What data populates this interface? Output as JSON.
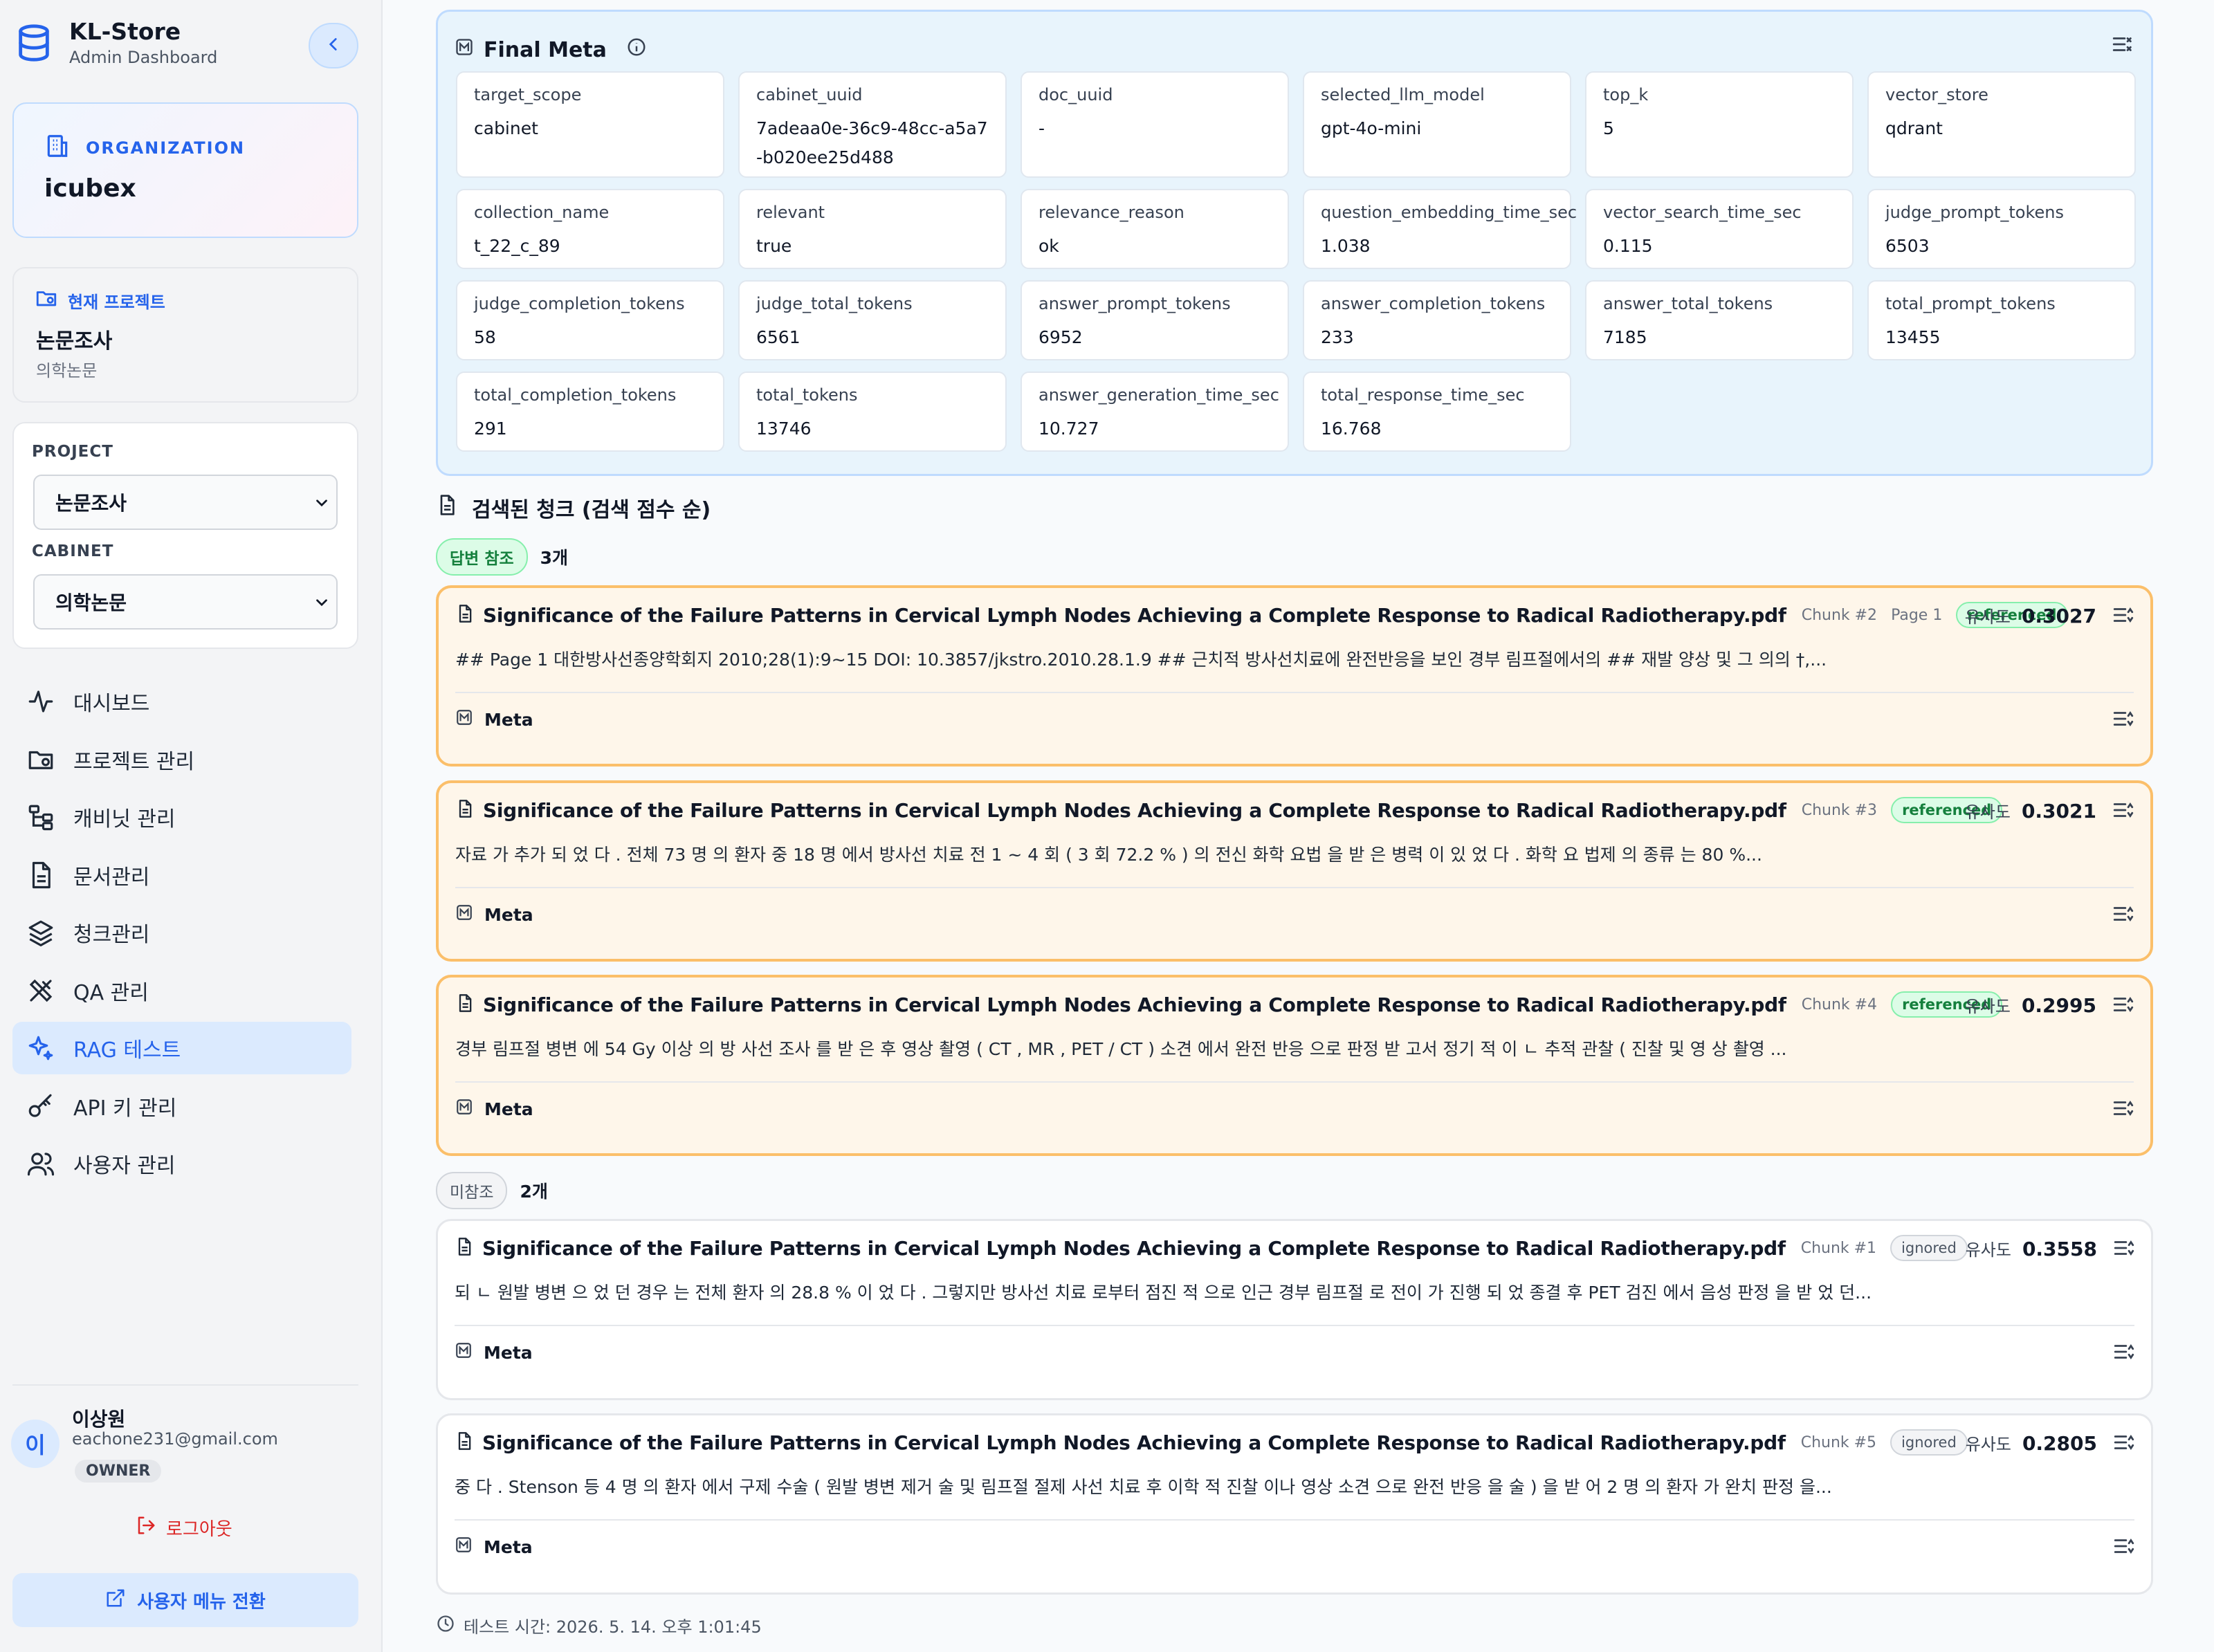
{
  "sidebar": {
    "brand_title": "KL-Store",
    "brand_sub": "Admin Dashboard",
    "org_label": "ORGANIZATION",
    "org_name": "icubex",
    "current_project_label": "현재 프로젝트",
    "current_project_name": "논문조사",
    "current_project_sub": "의학논문",
    "project_label": "PROJECT",
    "project_value": "논문조사",
    "cabinet_label": "CABINET",
    "cabinet_value": "의학논문",
    "nav": [
      {
        "label": "대시보드",
        "icon": "activity-icon"
      },
      {
        "label": "프로젝트 관리",
        "icon": "folder-cog-icon"
      },
      {
        "label": "캐비닛 관리",
        "icon": "tree-icon"
      },
      {
        "label": "문서관리",
        "icon": "file-text-icon"
      },
      {
        "label": "청크관리",
        "icon": "layers-icon"
      },
      {
        "label": "QA 관리",
        "icon": "tools-icon"
      },
      {
        "label": "RAG 테스트",
        "icon": "sparkles-icon",
        "active": true
      },
      {
        "label": "API 키 관리",
        "icon": "key-icon"
      },
      {
        "label": "사용자 관리",
        "icon": "users-icon"
      }
    ],
    "user": {
      "avatar": "이",
      "name": "이상원",
      "email": "eachone231@gmail.com",
      "role": "OWNER"
    },
    "logout": "로그아웃",
    "switch_menu": "사용자 메뉴 전환"
  },
  "final_meta": {
    "title": "Final Meta",
    "fields": [
      {
        "key": "target_scope",
        "value": "cabinet"
      },
      {
        "key": "cabinet_uuid",
        "value": "7adeaa0e-36c9-48cc-a5a7-b020ee25d488"
      },
      {
        "key": "doc_uuid",
        "value": "-"
      },
      {
        "key": "selected_llm_model",
        "value": "gpt-4o-mini"
      },
      {
        "key": "top_k",
        "value": "5"
      },
      {
        "key": "vector_store",
        "value": "qdrant"
      },
      {
        "key": "collection_name",
        "value": "t_22_c_89"
      },
      {
        "key": "relevant",
        "value": "true"
      },
      {
        "key": "relevance_reason",
        "value": "ok"
      },
      {
        "key": "question_embedding_time_sec",
        "value": "1.038"
      },
      {
        "key": "vector_search_time_sec",
        "value": "0.115"
      },
      {
        "key": "judge_prompt_tokens",
        "value": "6503"
      },
      {
        "key": "judge_completion_tokens",
        "value": "58"
      },
      {
        "key": "judge_total_tokens",
        "value": "6561"
      },
      {
        "key": "answer_prompt_tokens",
        "value": "6952"
      },
      {
        "key": "answer_completion_tokens",
        "value": "233"
      },
      {
        "key": "answer_total_tokens",
        "value": "7185"
      },
      {
        "key": "total_prompt_tokens",
        "value": "13455"
      },
      {
        "key": "total_completion_tokens",
        "value": "291"
      },
      {
        "key": "total_tokens",
        "value": "13746"
      },
      {
        "key": "answer_generation_time_sec",
        "value": "10.727"
      },
      {
        "key": "total_response_time_sec",
        "value": "16.768"
      }
    ]
  },
  "chunks_section": {
    "title": "검색된 청크 (검색 점수 순)",
    "referenced_badge": "답변 참조",
    "referenced_count": "3개",
    "unreferenced_badge": "미참조",
    "unreferenced_count": "2개",
    "score_label": "유사도",
    "meta_label": "Meta"
  },
  "chunks": [
    {
      "title": "Significance of the Failure Patterns in Cervical Lymph Nodes Achieving a Complete Response to Radical Radiotherapy.pdf",
      "chunk": "Chunk #2",
      "page": "Page 1",
      "status": "referenced",
      "score": "0.3027",
      "text": "## Page 1 대한방사선종양학회지 2010;28(1):9∼15 DOI: 10.3857/jkstro.2010.28.1.9 ## 근치적 방사선치료에 완전반응을 보인 경부 림프절에서의 ## 재발 양상 및 그 의의 †,..."
    },
    {
      "title": "Significance of the Failure Patterns in Cervical Lymph Nodes Achieving a Complete Response to Radical Radiotherapy.pdf",
      "chunk": "Chunk #3",
      "page": "",
      "status": "referenced",
      "score": "0.3021",
      "text": "자료 가 추가 되 었 다 . 전체 73 명 의 환자 중 18 명 에서 방사선 치료 전 1 ~ 4 회 ( 3 회 72.2 % ) 의 전신 화학 요법 을 받 은 병력 이 있 었 다 . 화학 요 법제 의 종류 는 80 %..."
    },
    {
      "title": "Significance of the Failure Patterns in Cervical Lymph Nodes Achieving a Complete Response to Radical Radiotherapy.pdf",
      "chunk": "Chunk #4",
      "page": "",
      "status": "referenced",
      "score": "0.2995",
      "text": "경부 림프절 병변 에 54 Gy 이상 의 방 사선 조사 를 받 은 후 영상 촬영 ( CT , MR , PET / CT ) 소견 에서 완전 반응 으로 판정 받 고서 정기 적 이 ㄴ 추적 관찰 ( 진찰 및 영 상 촬영 ..."
    },
    {
      "title": "Significance of the Failure Patterns in Cervical Lymph Nodes Achieving a Complete Response to Radical Radiotherapy.pdf",
      "chunk": "Chunk #1",
      "page": "",
      "status": "ignored",
      "score": "0.3558",
      "text": "되 ㄴ 원발 병변 으 었 던 경우 는 전체 환자 의 28.8 % 이 었 다 . 그렇지만 방사선 치료 로부터 점진 적 으로 인근 경부 림프절 로 전이 가 진행 되 었 종결 후 PET 검진 에서 음성 판정 을 받 었 던..."
    },
    {
      "title": "Significance of the Failure Patterns in Cervical Lymph Nodes Achieving a Complete Response to Radical Radiotherapy.pdf",
      "chunk": "Chunk #5",
      "page": "",
      "status": "ignored",
      "score": "0.2805",
      "text": "중 다 . Stenson 등 4 명 의 환자 에서 구제 수술 ( 원발 병변 제거 술 및 림프절 절제 사선 치료 후 이학 적 진찰 이나 영상 소견 으로 완전 반응 을 술 ) 을 받 어 2 명 의 환자 가 완치 판정 을..."
    }
  ],
  "footer": {
    "test_time": "테스트 시간: 2026. 5. 14. 오후 1:01:45"
  },
  "colors": {
    "accent": "#2563eb",
    "referenced_border": "#fbbf6a",
    "referenced_bg": "#fef6ea",
    "meta_panel_bg": "#e8f4fc",
    "logout": "#dc2626"
  }
}
